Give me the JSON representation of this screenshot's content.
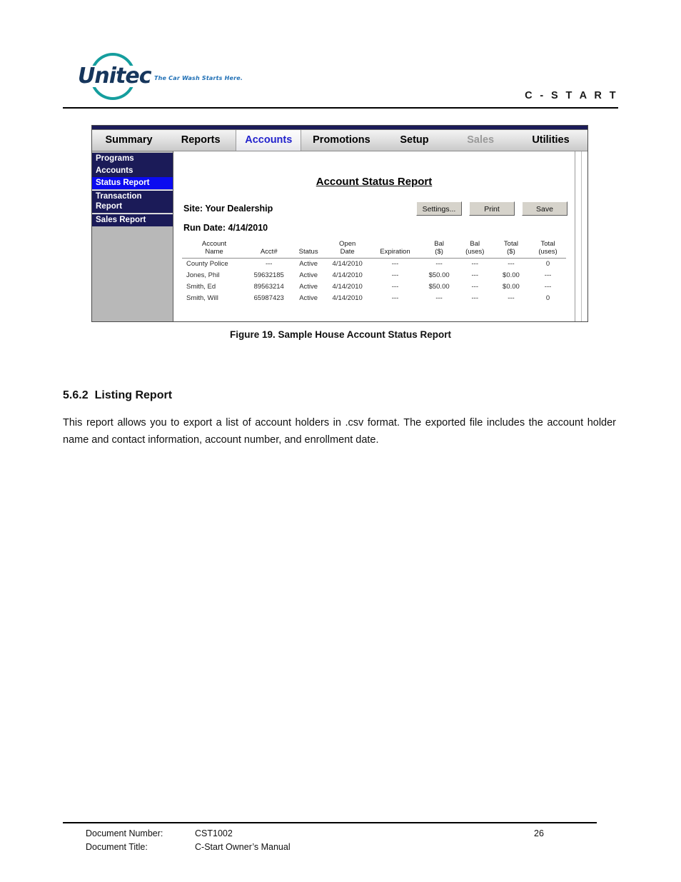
{
  "header": {
    "logo_word": "Unitec",
    "logo_tagline": "The Car Wash Starts Here.",
    "product_title": "C - S T A R T"
  },
  "app_window": {
    "tabs": [
      {
        "label": "Summary",
        "state": "normal"
      },
      {
        "label": "Reports",
        "state": "normal"
      },
      {
        "label": "Accounts",
        "state": "active"
      },
      {
        "label": "Promotions",
        "state": "normal"
      },
      {
        "label": "Setup",
        "state": "normal"
      },
      {
        "label": "Sales",
        "state": "disabled"
      },
      {
        "label": "Utilities",
        "state": "normal"
      }
    ],
    "sidebar": {
      "items": [
        {
          "label": "Programs",
          "active": false
        },
        {
          "label": "Accounts",
          "active": false
        },
        {
          "label": "Status Report",
          "active": true
        },
        {
          "label": "Transaction Report",
          "active": false
        },
        {
          "label": "Sales Report",
          "active": false
        }
      ],
      "active_color": "#0b0bf0",
      "base_color": "#1b1b58"
    },
    "report": {
      "title": "Account Status Report",
      "site_line": "Site: Your Dealership",
      "run_date_line": "Run Date: 4/14/2010",
      "buttons": [
        {
          "label": "Settings..."
        },
        {
          "label": "Print"
        },
        {
          "label": "Save"
        }
      ],
      "columns": [
        "Account Name",
        "Acct#",
        "Status",
        "Open Date",
        "Expiration",
        "Bal ($)",
        "Bal (uses)",
        "Total ($)",
        "Total (uses)"
      ],
      "columns_split": [
        {
          "line1": "Account",
          "line2": "Name"
        },
        {
          "line1": "Acct#",
          "line2": ""
        },
        {
          "line1": "Status",
          "line2": ""
        },
        {
          "line1": "Open",
          "line2": "Date"
        },
        {
          "line1": "Expiration",
          "line2": ""
        },
        {
          "line1": "Bal",
          "line2": "($)"
        },
        {
          "line1": "Bal",
          "line2": "(uses)"
        },
        {
          "line1": "Total",
          "line2": "($)"
        },
        {
          "line1": "Total",
          "line2": "(uses)"
        }
      ],
      "rows": [
        {
          "name": "County Police",
          "acct": "---",
          "status": "Active",
          "open_date": "4/14/2010",
          "expiration": "---",
          "bal_dollars": "---",
          "bal_uses": "---",
          "total_dollars": "---",
          "total_uses": "0"
        },
        {
          "name": "Jones, Phil",
          "acct": "59632185",
          "status": "Active",
          "open_date": "4/14/2010",
          "expiration": "---",
          "bal_dollars": "$50.00",
          "bal_uses": "---",
          "total_dollars": "$0.00",
          "total_uses": "---"
        },
        {
          "name": "Smith, Ed",
          "acct": "89563214",
          "status": "Active",
          "open_date": "4/14/2010",
          "expiration": "---",
          "bal_dollars": "$50.00",
          "bal_uses": "---",
          "total_dollars": "$0.00",
          "total_uses": "---"
        },
        {
          "name": "Smith, Will",
          "acct": "65987423",
          "status": "Active",
          "open_date": "4/14/2010",
          "expiration": "---",
          "bal_dollars": "---",
          "bal_uses": "---",
          "total_dollars": "---",
          "total_uses": "0"
        }
      ]
    }
  },
  "figure": {
    "caption": "Figure 19. Sample House Account Status Report"
  },
  "section": {
    "number": "5.6.2",
    "heading": "Listing Report",
    "paragraph": "This report allows you to export a list of account holders in .csv format. The exported file includes the account holder name and contact information, account number, and enrollment date."
  },
  "footer": {
    "doc_number_label": "Document Number:",
    "doc_number_value": "CST1002",
    "doc_title_label": "Document Title:",
    "doc_title_value": "C-Start Owner’s Manual",
    "page_number": "26"
  }
}
